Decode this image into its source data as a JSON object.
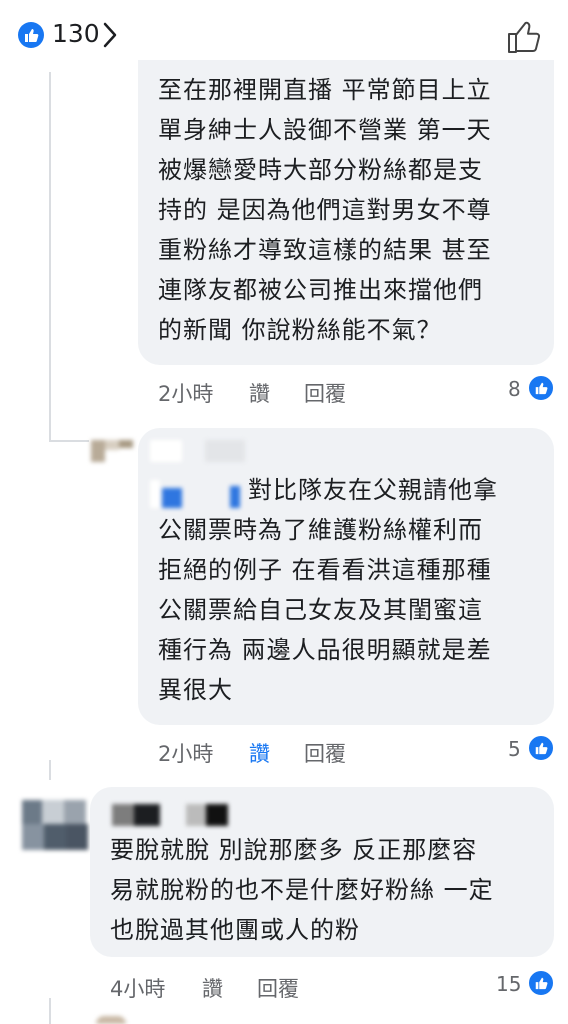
{
  "header": {
    "reaction_count": "130",
    "icons": {
      "like_badge": "like-icon",
      "chevron": "chevron-right-icon",
      "like_button": "thumbs-up-outline-icon"
    }
  },
  "comments": [
    {
      "lines": [
        "至在那裡開直播 平常節目上立",
        "單身紳士人設御不營業 第一天",
        "被爆戀愛時大部分粉絲都是支",
        "持的 是因為他們這對男女不尊",
        "重粉絲才導致這樣的結果 甚至",
        "連隊友都被公司推出來擋他們",
        "的新聞 你說粉絲能不氣？"
      ],
      "time": "2小時",
      "like_label": "讚",
      "reply_label": "回覆",
      "reactions": "8"
    },
    {
      "lines": [
        "對比隊友在父親請他拿",
        "公關票時為了維護粉絲權利而",
        "拒絕的例子 在看看洪這種那種",
        "公關票給自己女友及其閨蜜這",
        "種行為 兩邊人品很明顯就是差",
        "異很大"
      ],
      "time": "2小時",
      "like_label": "讚",
      "reply_label": "回覆",
      "reactions": "5"
    },
    {
      "lines": [
        "要脫就脫 別說那麼多 反正那麼容",
        "易就脫粉的也不是什麼好粉絲 一定",
        "也脫過其他團或人的粉"
      ],
      "time": "4小時",
      "like_label": "讚",
      "reply_label": "回覆",
      "reactions": "15"
    }
  ],
  "colors": {
    "accent": "#1877f2",
    "bubble": "#f0f2f5",
    "secondary_text": "#65676b"
  }
}
